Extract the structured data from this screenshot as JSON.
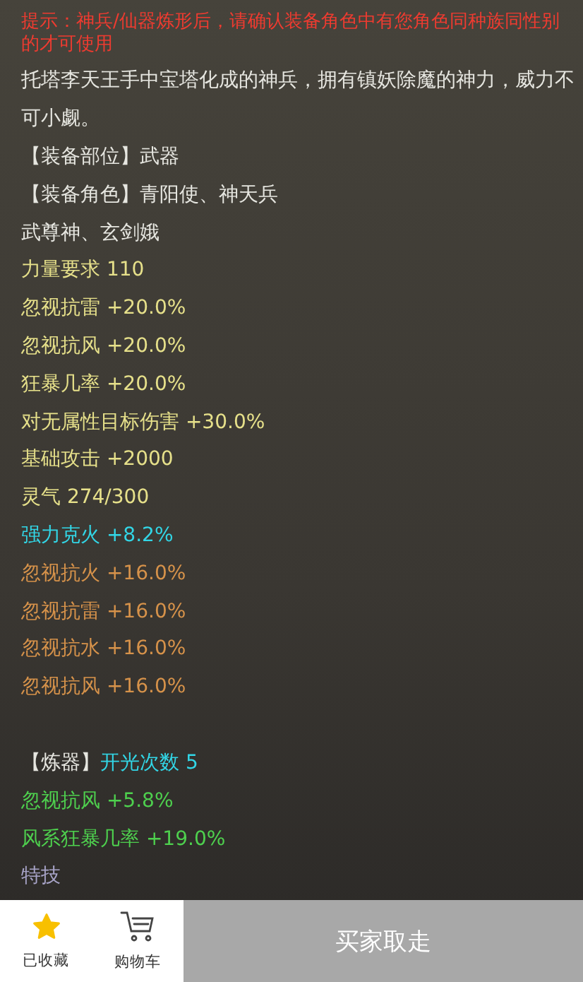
{
  "notice": "提示：神兵/仙器炼形后，请确认装备角色中有您角色同种族同性别的才可使用",
  "description": "托塔李天王手中宝塔化成的神兵，拥有镇妖除魔的神力，威力不可小觑。",
  "sections": [
    {
      "lines": [
        [
          {
            "kind": "white",
            "text": "【装备部位】武器"
          }
        ],
        [
          {
            "kind": "white",
            "text": "【装备角色】青阳使、神天兵"
          }
        ],
        [
          {
            "kind": "white",
            "text": "武尊神、玄剑娥"
          }
        ],
        [
          {
            "kind": "yellow",
            "text": "力量要求 110"
          }
        ],
        [
          {
            "kind": "yellow",
            "text": "忽视抗雷 +20.0%"
          }
        ],
        [
          {
            "kind": "yellow",
            "text": "忽视抗风 +20.0%"
          }
        ],
        [
          {
            "kind": "yellow",
            "text": "狂暴几率 +20.0%"
          }
        ],
        [
          {
            "kind": "yellow",
            "text": "对无属性目标伤害 +30.0%"
          }
        ],
        [
          {
            "kind": "yellow",
            "text": "基础攻击 +2000"
          }
        ],
        [
          {
            "kind": "yellow",
            "text": "灵气 274/300"
          }
        ],
        [
          {
            "kind": "cyan",
            "text": "强力克火 +8.2%"
          }
        ],
        [
          {
            "kind": "orange",
            "text": "忽视抗火 +16.0%"
          }
        ],
        [
          {
            "kind": "orange",
            "text": "忽视抗雷 +16.0%"
          }
        ],
        [
          {
            "kind": "orange",
            "text": "忽视抗水 +16.0%"
          }
        ],
        [
          {
            "kind": "orange",
            "text": "忽视抗风 +16.0%"
          }
        ]
      ]
    },
    {
      "lines": [
        [
          {
            "kind": "white",
            "text": "【炼器】"
          },
          {
            "kind": "cyan",
            "text": "开光次数 5"
          }
        ],
        [
          {
            "kind": "green",
            "text": "忽视抗风 +5.8%"
          }
        ],
        [
          {
            "kind": "green",
            "text": "风系狂暴几率 +19.0%"
          }
        ],
        [
          {
            "kind": "purple",
            "text": "特技"
          }
        ]
      ]
    }
  ],
  "footer": {
    "favorite": {
      "label": "已收藏",
      "selected": true
    },
    "cart": {
      "label": "购物车"
    },
    "action": {
      "label": "买家取走",
      "disabled": true
    }
  }
}
